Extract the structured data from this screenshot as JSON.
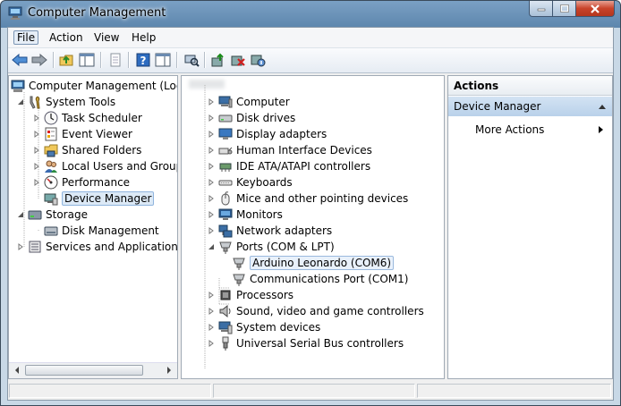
{
  "window": {
    "title": "Computer Management"
  },
  "menu": {
    "file": "File",
    "action": "Action",
    "view": "View",
    "help": "Help"
  },
  "left_tree": {
    "root": "Computer Management (Local",
    "system_tools": "System Tools",
    "task_scheduler": "Task Scheduler",
    "event_viewer": "Event Viewer",
    "shared_folders": "Shared Folders",
    "local_users": "Local Users and Groups",
    "performance": "Performance",
    "device_manager": "Device Manager",
    "storage": "Storage",
    "disk_management": "Disk Management",
    "services": "Services and Applications"
  },
  "devices": {
    "computer": "Computer",
    "disk_drives": "Disk drives",
    "display_adapters": "Display adapters",
    "hid": "Human Interface Devices",
    "ide": "IDE ATA/ATAPI controllers",
    "keyboards": "Keyboards",
    "mice": "Mice and other pointing devices",
    "monitors": "Monitors",
    "network": "Network adapters",
    "ports": "Ports (COM & LPT)",
    "arduino": "Arduino Leonardo (COM6)",
    "comm_port": "Communications Port (COM1)",
    "processors": "Processors",
    "sound": "Sound, video and game controllers",
    "system_devices": "System devices",
    "usb": "Universal Serial Bus controllers"
  },
  "actions": {
    "header": "Actions",
    "section": "Device Manager",
    "more_actions": "More Actions"
  }
}
